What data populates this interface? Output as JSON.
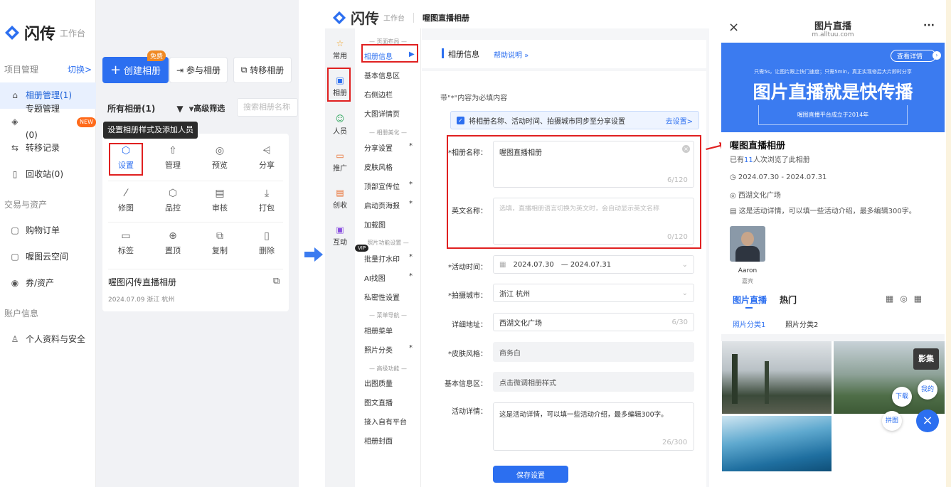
{
  "left": {
    "logo_text": "闪传",
    "logo_sub": "工作台",
    "section_project": "项目管理",
    "switch_label": "切换>",
    "side_items": [
      {
        "icon": "album-icon",
        "label": "相册管理(1)"
      },
      {
        "icon": "topic-icon",
        "label": "专题管理(0)",
        "badge": "NEW"
      },
      {
        "icon": "transfer-icon",
        "label": "转移记录"
      },
      {
        "icon": "trash-icon",
        "label": "回收站(0)"
      }
    ],
    "section_trade": "交易与资产",
    "trade_items": [
      {
        "icon": "order-icon",
        "label": "购物订单"
      },
      {
        "icon": "cloud-icon",
        "label": "喔图云空间"
      },
      {
        "icon": "coupon-icon",
        "label": "券/资产"
      }
    ],
    "section_account": "账户信息",
    "account_items": [
      {
        "icon": "user-icon",
        "label": "个人资料与安全"
      }
    ],
    "create_btn": "创建相册",
    "free_badge": "免费",
    "join_btn": "参与相册",
    "move_btn": "转移相册",
    "all_albums": "所有相册(1)",
    "filter_btn": "高级筛选",
    "search_placeholder": "搜索相册名称",
    "tooltip": "设置相册样式及添加人员",
    "actions": [
      {
        "icon": "settings-icon",
        "label": "设置"
      },
      {
        "icon": "manage-icon",
        "label": "管理"
      },
      {
        "icon": "preview-icon",
        "label": "预览"
      },
      {
        "icon": "share-icon",
        "label": "分享"
      },
      {
        "icon": "retouch-icon",
        "label": "修图"
      },
      {
        "icon": "quality-icon",
        "label": "品控"
      },
      {
        "icon": "review-icon",
        "label": "审核"
      },
      {
        "icon": "pack-icon",
        "label": "打包"
      },
      {
        "icon": "tag-icon",
        "label": "标签"
      },
      {
        "icon": "pin-icon",
        "label": "置顶"
      },
      {
        "icon": "copy-icon",
        "label": "复制"
      },
      {
        "icon": "delete-icon",
        "label": "删除"
      }
    ],
    "album_title": "喔图闪传直播相册",
    "album_meta": "2024.07.09 浙江 杭州"
  },
  "middle": {
    "logo_text": "闪传",
    "logo_sub": "工作台",
    "page_title": "喔图直播相册",
    "rail": [
      {
        "icon": "star-icon",
        "label": "常用"
      },
      {
        "icon": "album-icon",
        "label": "相册"
      },
      {
        "icon": "people-icon",
        "label": "人员"
      },
      {
        "icon": "promo-icon",
        "label": "推广"
      },
      {
        "icon": "create-icon",
        "label": "创收"
      },
      {
        "icon": "interact-icon",
        "label": "互动"
      }
    ],
    "menu_sections": [
      "— 页面布局 —",
      "— 相册美化 —",
      "照片功能设置 —",
      "— 菜单导航 —",
      "— 高级功能 —"
    ],
    "menu_items": [
      "相册信息",
      "基本信息区",
      "右侧边栏",
      "大图详情页",
      "分享设置",
      "皮肤风格",
      "顶部宣传位",
      "启动页海报",
      "加载图",
      "批量打水印",
      "AI找图",
      "私密性设置",
      "相册菜单",
      "照片分类",
      "出图质量",
      "图文直播",
      "接入自有平台",
      "相册封面"
    ],
    "vip_badge": "VIP",
    "form_title": "相册信息",
    "help_link": "帮助说明 »",
    "required_note": "带\"*\"内容为必填内容",
    "sync_note": "将相册名称、活动时间、拍摄城市同步至分享设置",
    "sync_link": "去设置>",
    "name_label": "*相册名称：",
    "name_value": "喔图直播相册",
    "name_count": "6/120",
    "en_label": "英文名称：",
    "en_placeholder": "选填，直播相册语言切换为英文时，会自动显示英文名称",
    "en_count": "0/120",
    "time_label": "*活动时间：",
    "time_start": "2024.07.30",
    "time_end": "— 2024.07.31",
    "city_label": "*拍摄城市：",
    "city_value": "浙江 杭州",
    "addr_label": "详细地址：",
    "addr_value": "西湖文化广场",
    "addr_count": "6/30",
    "skin_label": "*皮肤风格：",
    "skin_value": "商务白",
    "basic_label": "基本信息区：",
    "basic_value": "点击微调相册样式",
    "detail_label": "活动详情：",
    "detail_value": "这是活动详情，可以填一些活动介绍，最多编辑300字。",
    "detail_count": "26/300",
    "save_btn": "保存设置"
  },
  "right": {
    "title": "图片直播",
    "domain": "m.alltuu.com",
    "banner_tag": "查看详情",
    "banner_small": "只需5s，让图片跟上快门速度；只需5min，真正实现修后大片即时分享",
    "banner_big": "图片直播就是快传播",
    "banner_foot": "喔图直播平台成立于2014年",
    "album_name": "喔图直播相册",
    "views_pre": "已有",
    "views_num": "11",
    "views_post": "人次浏览了此相册",
    "date": "2024.07.30 - 2024.07.31",
    "place": "西湖文化广场",
    "desc": "这是活动详情，可以填一些活动介绍，最多编辑300字。",
    "person_name": "Aaron",
    "person_role": "嘉宾",
    "tab_live": "图片直播",
    "tab_hot": "热门",
    "cat1": "照片分类1",
    "cat2": "照片分类2",
    "film_label": "影集",
    "fab_download": "下载",
    "fab_mine": "我的",
    "fab_puzzle": "拼图"
  },
  "colors": {
    "accent": "#2c6ff0",
    "red": "#e02020",
    "orange": "#f08a24"
  }
}
